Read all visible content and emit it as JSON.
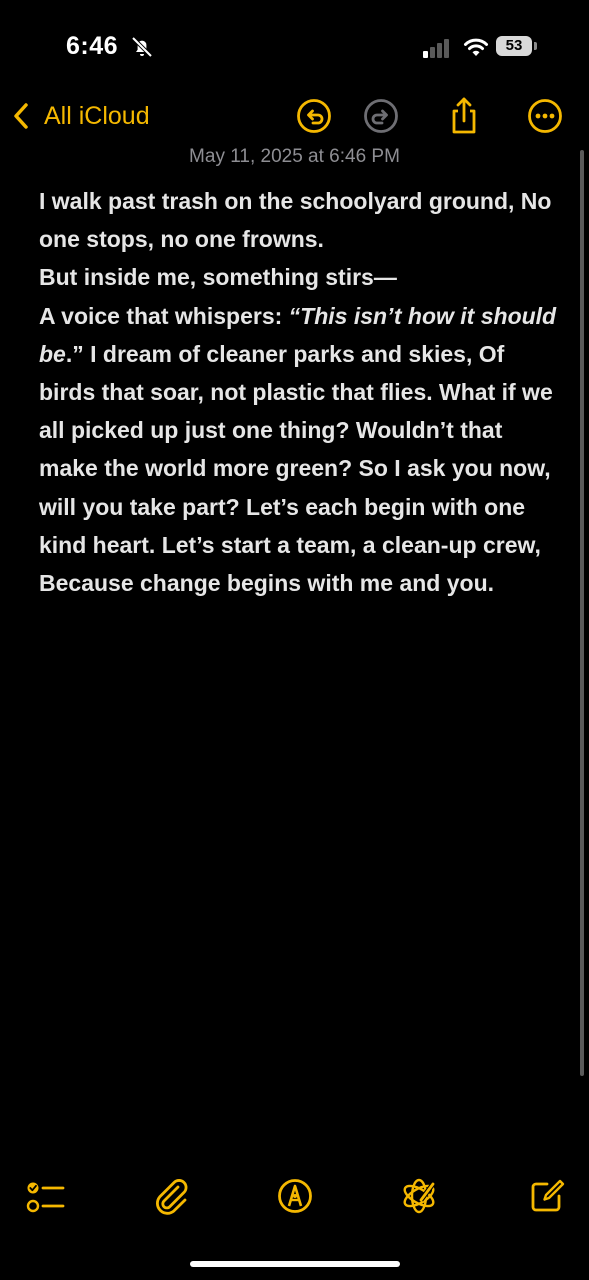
{
  "status_bar": {
    "time": "6:46",
    "battery": "53",
    "icons": [
      "bell-slash-icon",
      "cellular-signal-icon",
      "wifi-icon",
      "battery-icon"
    ]
  },
  "nav": {
    "back_label": "All iCloud",
    "icons": [
      "chevron-left-icon",
      "undo-icon",
      "redo-icon",
      "share-icon",
      "more-icon"
    ]
  },
  "note": {
    "date": "May 11, 2025 at 6:46 PM",
    "line1": "I walk past trash on the schoolyard ground, No one stops, no one frowns.",
    "line2": "But inside me, something stirs—",
    "line3_prefix": "A voice that whispers: ",
    "line3_quote": "“This isn’t how it should be",
    "line3_rest": ".” I dream of cleaner parks and skies, Of birds that soar, not plastic that flies. What if we all picked up just one thing? Wouldn’t that make the world more green? So I ask you now, will you take part? Let’s each begin with one kind heart. Let’s start a team, a clean-up crew, Because change begins with me and you."
  },
  "toolbar": {
    "icons": [
      "checklist-icon",
      "paperclip-icon",
      "markup-icon",
      "apple-intelligence-icon",
      "compose-icon"
    ]
  },
  "colors": {
    "accent": "#f5b800",
    "background": "#000000",
    "text": "#e6e6e6",
    "secondary_text": "#8e8e93",
    "disabled": "#6e6e73"
  }
}
